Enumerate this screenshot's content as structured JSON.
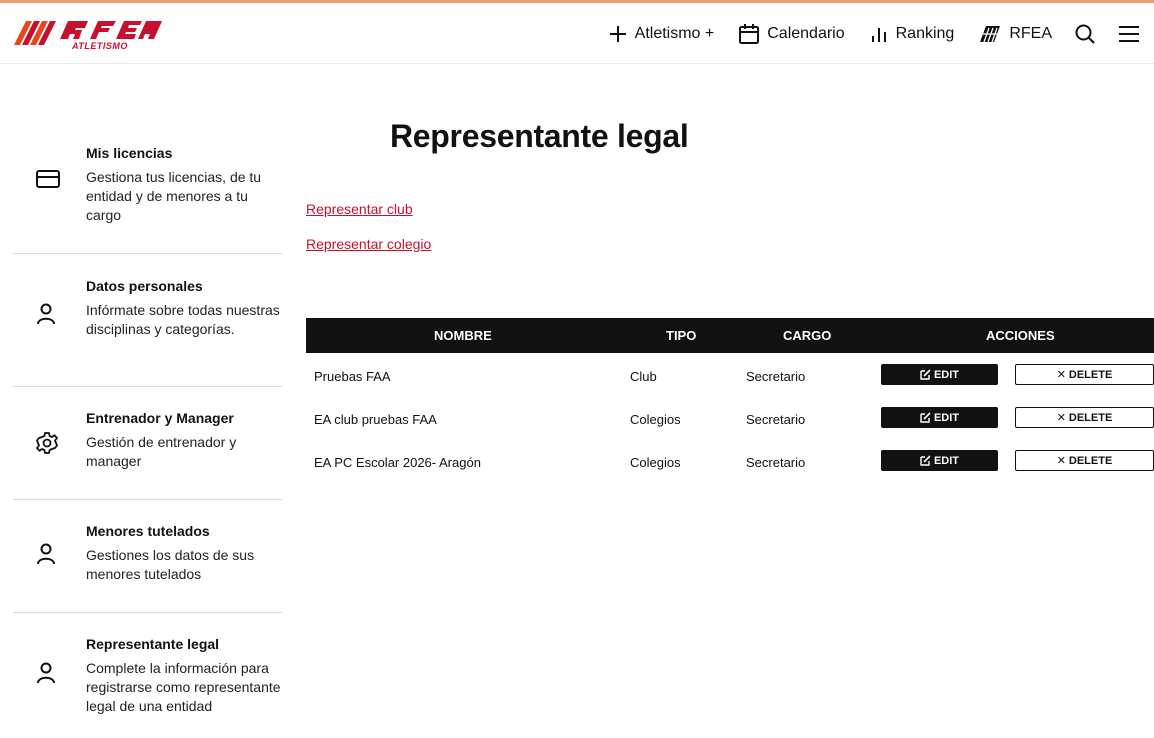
{
  "brand": {
    "logo_text": "RFEA",
    "logo_subtext": "ATLETISMO",
    "colors": {
      "red": "#c8102e",
      "orange": "#e8461d"
    }
  },
  "nav": {
    "atletismo_plus": "Atletismo +",
    "calendario": "Calendario",
    "ranking": "Ranking",
    "rfea": "RFEA"
  },
  "sidebar": {
    "items": [
      {
        "title": "Mis licencias",
        "desc": "Gestiona tus licencias, de tu entidad y de menores a tu cargo",
        "icon": "card-icon"
      },
      {
        "title": "Datos personales",
        "desc": "Infórmate sobre todas nuestras disciplinas y categorías.",
        "icon": "person-icon"
      },
      {
        "title": "Entrenador y Manager",
        "desc": "Gestión de entrenador y manager",
        "icon": "gear-icon"
      },
      {
        "title": "Menores tutelados",
        "desc": "Gestiones los datos de sus menores tutelados",
        "icon": "person-icon"
      },
      {
        "title": "Representante legal",
        "desc": "Complete la información para registrarse como representante legal de una entidad",
        "icon": "person-icon"
      }
    ]
  },
  "main": {
    "title": "Representante legal",
    "link_club": "Representar club",
    "link_colegio": "Representar colegio"
  },
  "table": {
    "headers": {
      "nombre": "NOMBRE",
      "tipo": "TIPO",
      "cargo": "CARGO",
      "acciones": "ACCIONES"
    },
    "edit_label": "EDIT",
    "delete_label": "DELETE",
    "rows": [
      {
        "nombre": "Pruebas FAA",
        "tipo": "Club",
        "cargo": "Secretario"
      },
      {
        "nombre": "EA club pruebas FAA",
        "tipo": "Colegios",
        "cargo": "Secretario"
      },
      {
        "nombre": "EA PC Escolar 2026- Aragón",
        "tipo": "Colegios",
        "cargo": "Secretario"
      }
    ]
  }
}
